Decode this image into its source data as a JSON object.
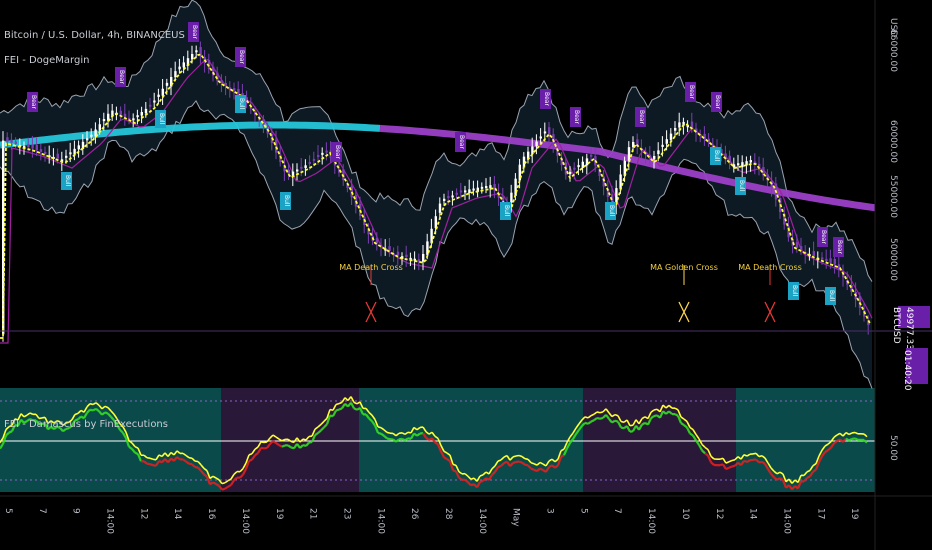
{
  "header": {
    "title": "Bitcoin / U.S. Dollar, 4h, BINANCEUS",
    "indicator_main": "FEI - DogeMargin",
    "indicator_sub": "FEI - Damascus by FinExecutions"
  },
  "price_scale": {
    "labels": [
      "66000.00",
      "60000.00",
      "55000.00",
      "50000.00"
    ],
    "currency": "USD"
  },
  "osc_scale": {
    "mid_label": "50.00"
  },
  "last_price": {
    "symbol": "BTCUSD",
    "value": "49977.33",
    "countdown": "01:40:20"
  },
  "time_axis": {
    "labels": [
      "5",
      "7",
      "9",
      "14:00",
      "12",
      "14",
      "16",
      "14:00",
      "19",
      "21",
      "23",
      "14:00",
      "26",
      "28",
      "14:00",
      "May",
      "3",
      "5",
      "7",
      "14:00",
      "10",
      "12",
      "14",
      "14:00",
      "17",
      "19"
    ]
  },
  "annotations": {
    "cross_labels": [
      "MA Death Cross",
      "MA Golden Cross",
      "MA Death Cross"
    ],
    "bear_label": "Bear",
    "bull_label": "Bull"
  },
  "colors": {
    "background": "#000000",
    "candle_up": "#ffffff",
    "candle_down": "#7b3fb4",
    "ma_fast": "#ffff33",
    "ma_mid": "#a020a0",
    "ma_slow_bull": "#26c6da",
    "ma_slow_bear": "#9c3fc8",
    "band_fill": "#0d1a24",
    "band_line": "#9aa4b0",
    "bear_badge": "#6a1fa8",
    "bull_badge": "#1aa3c4",
    "death_cross": "#e53935",
    "golden_cross": "#ffd54f",
    "osc_bull_zone": "#0b4a4a",
    "osc_bear_zone": "#2a1838",
    "osc_line": "#ffff33",
    "osc_green": "#33dd22",
    "osc_red": "#e02020"
  },
  "chart_data": {
    "type": "line",
    "x_range": [
      "Apr 5",
      "May 19"
    ],
    "ylim": [
      46000,
      66500
    ],
    "series": [],
    "oscillator_ylim": [
      0,
      100
    ],
    "oscillator_midline": 50
  }
}
